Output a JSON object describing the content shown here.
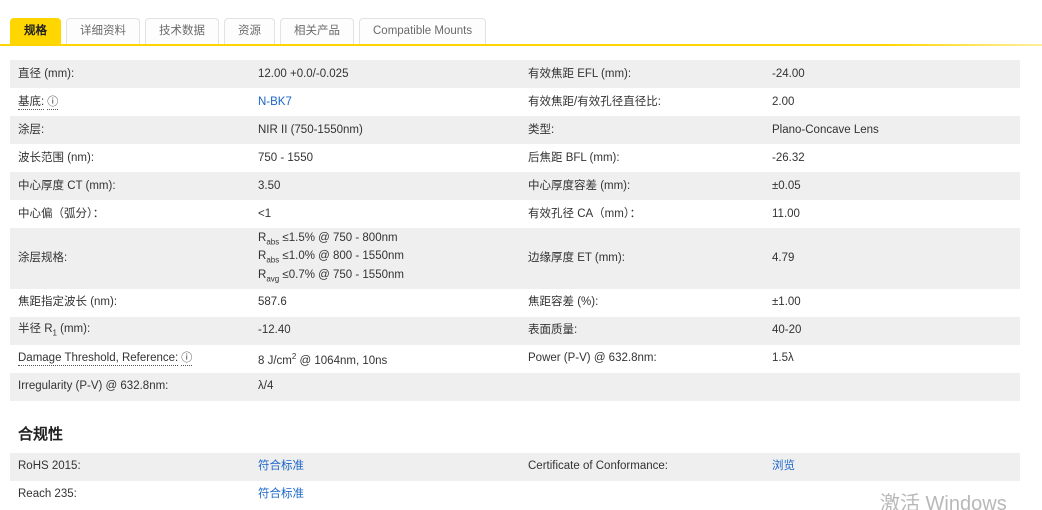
{
  "colors": {
    "accent_yellow": "#FFD600",
    "link_blue": "#1B66C9",
    "row_stripe": "#EFEFEF",
    "text": "#333333",
    "watermark_gray": "#B8B8B8"
  },
  "tabs": [
    {
      "label": "规格",
      "active": true
    },
    {
      "label": "详细资料",
      "active": false
    },
    {
      "label": "技术数据",
      "active": false
    },
    {
      "label": "资源",
      "active": false
    },
    {
      "label": "相关产品",
      "active": false
    },
    {
      "label": "Compatible Mounts",
      "active": false
    }
  ],
  "spec_table": {
    "rows": [
      {
        "left": {
          "label": "直径 (mm):",
          "value": "12.00 +0.0/-0.025"
        },
        "right": {
          "label": "有效焦距 EFL (mm):",
          "value": "-24.00"
        }
      },
      {
        "left": {
          "label": "基底:",
          "info": true,
          "value": "N-BK7",
          "link": true
        },
        "right": {
          "label": "有效焦距/有效孔径直径比:",
          "value": "2.00"
        }
      },
      {
        "left": {
          "label": "涂层:",
          "value": "NIR II (750-1550nm)"
        },
        "right": {
          "label": "类型:",
          "value": "Plano-Concave Lens"
        }
      },
      {
        "left": {
          "label": "波长范围 (nm):",
          "value": "750 - 1550"
        },
        "right": {
          "label": "后焦距 BFL (mm):",
          "value": "-26.32"
        }
      },
      {
        "left": {
          "label": "中心厚度 CT (mm):",
          "value": "3.50"
        },
        "right": {
          "label": "中心厚度容差 (mm):",
          "value": "±0.05"
        }
      },
      {
        "left": {
          "label": "中心偏（弧分）：",
          "value": "<1"
        },
        "right": {
          "label": "有效孔径 CA（mm）：",
          "value": "11.00"
        }
      },
      {
        "left": {
          "label": "涂层规格:",
          "lines": [
            "R_{abs} ≤1.5% @ 750 - 800nm",
            "R_{abs} ≤1.0% @ 800 - 1550nm",
            "R_{avg} ≤0.7% @ 750 - 1550nm"
          ]
        },
        "right": {
          "label": "边缘厚度 ET (mm):",
          "value": "4.79"
        }
      },
      {
        "left": {
          "label": "焦距指定波长 (nm):",
          "value": "587.6"
        },
        "right": {
          "label": "焦距容差 (%):",
          "value": "±1.00"
        }
      },
      {
        "left": {
          "label": "半径 R_{1} (mm):",
          "value": "-12.40"
        },
        "right": {
          "label": "表面质量:",
          "value": "40-20"
        }
      },
      {
        "left": {
          "label": "Damage Threshold, Reference:",
          "info": true,
          "value": "8 J/cm^{2} @ 1064nm, 10ns"
        },
        "right": {
          "label": "Power (P-V) @ 632.8nm:",
          "value": "1.5λ"
        }
      },
      {
        "left": {
          "label": "Irregularity (P-V) @ 632.8nm:",
          "value": "λ/4"
        },
        "right": {
          "label": "",
          "value": ""
        }
      }
    ]
  },
  "compliance": {
    "heading": "合规性",
    "rows": [
      {
        "left": {
          "label": "RoHS 2015:",
          "value": "符合标准",
          "link": true
        },
        "right": {
          "label": "Certificate of Conformance:",
          "value": "浏览",
          "link": true
        }
      },
      {
        "left": {
          "label": "Reach 235:",
          "value": "符合标准",
          "link": true
        },
        "right": {
          "label": "",
          "value": ""
        }
      }
    ]
  },
  "watermark": "激活 Windows"
}
